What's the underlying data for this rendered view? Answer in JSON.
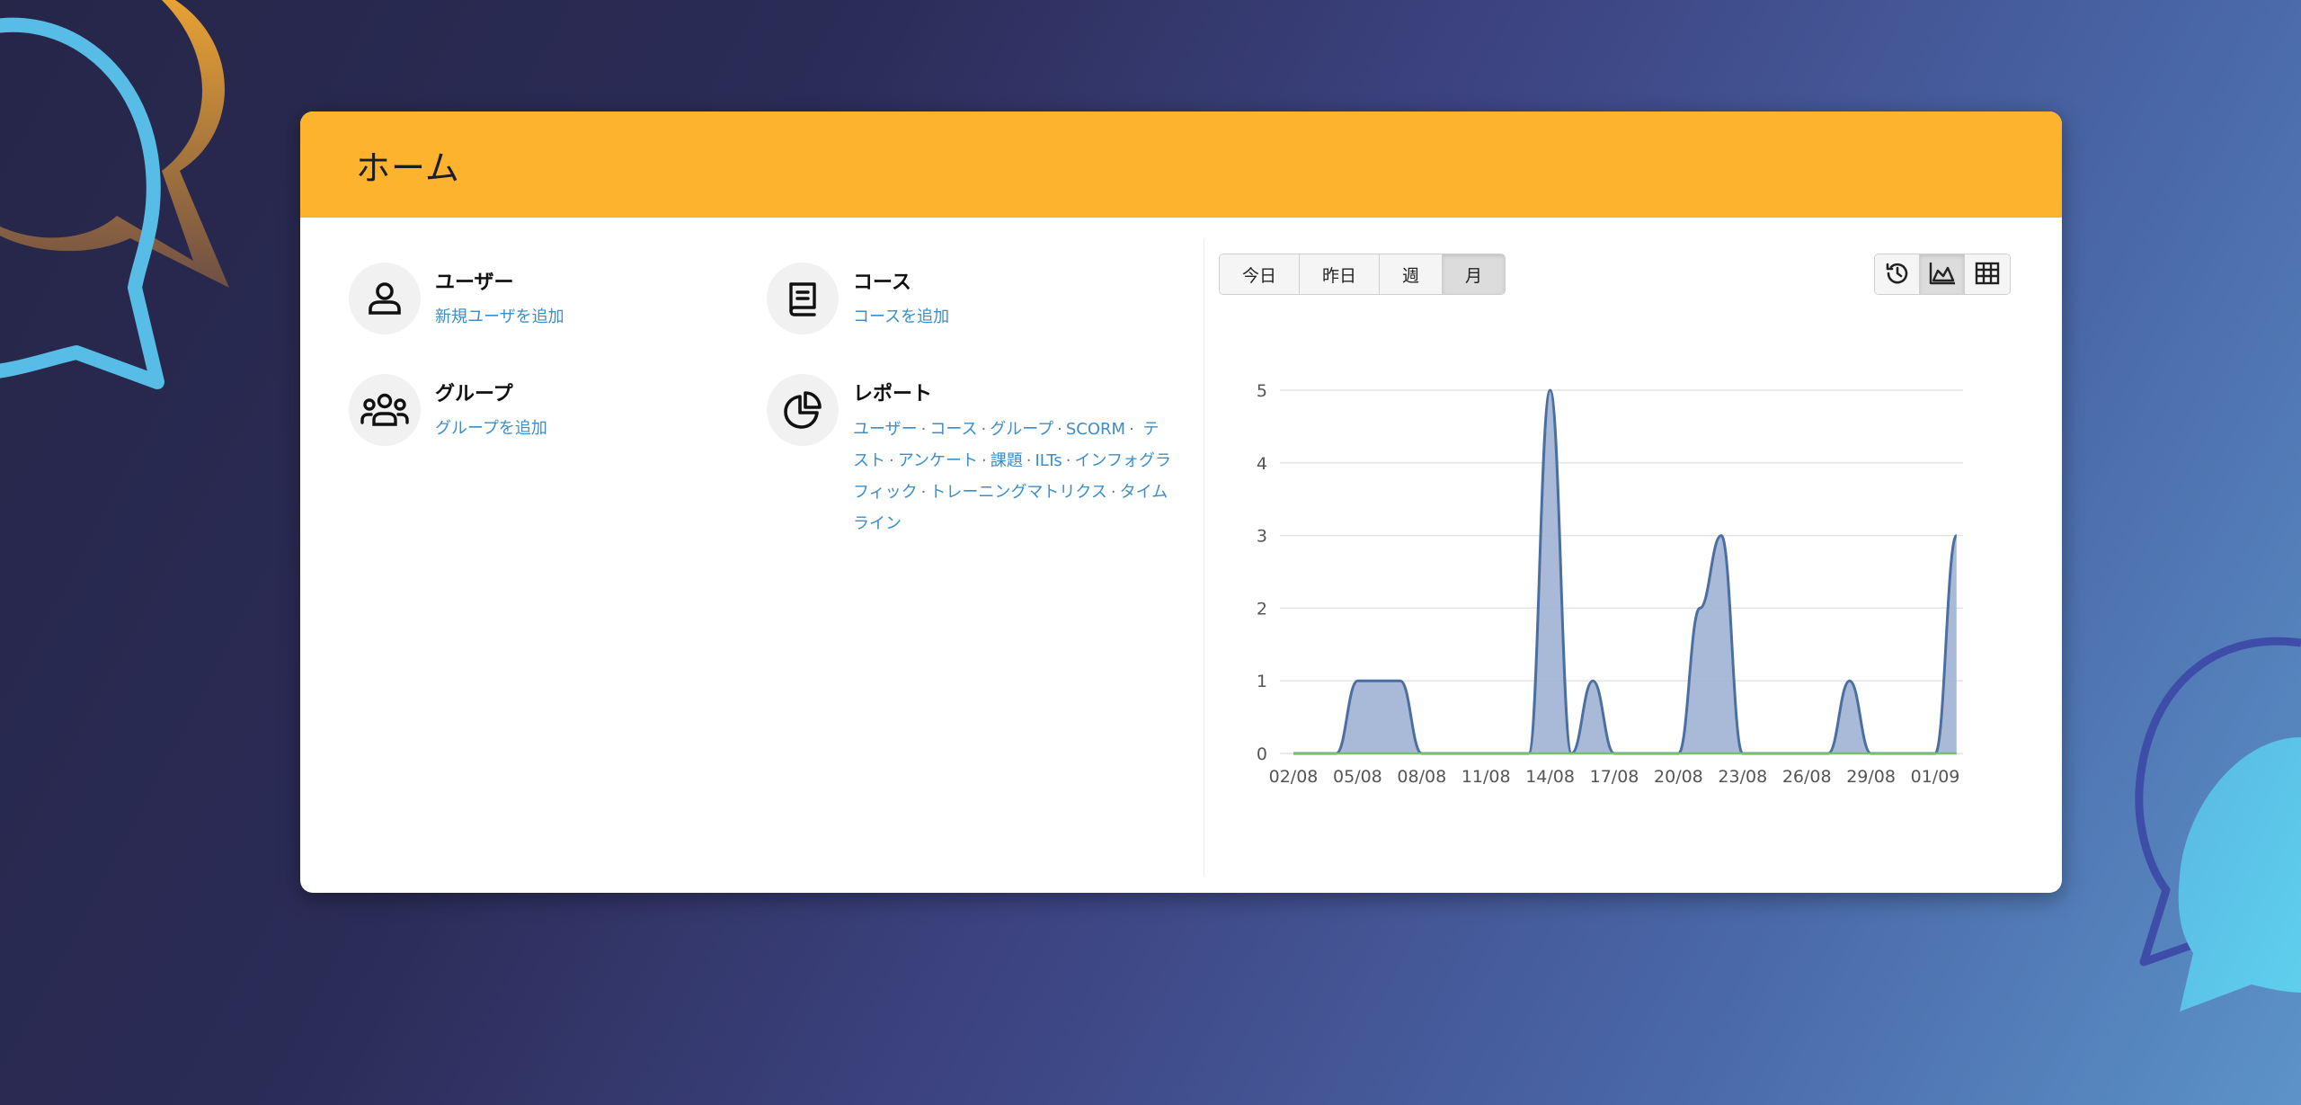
{
  "header": {
    "title": "ホーム"
  },
  "nav": {
    "users": {
      "title": "ユーザー",
      "link": "新規ユーザを追加",
      "icon": "user-icon"
    },
    "courses": {
      "title": "コース",
      "link": "コースを追加",
      "icon": "book-icon"
    },
    "groups": {
      "title": "グループ",
      "link": "グループを追加",
      "icon": "group-icon"
    },
    "reports": {
      "title": "レポート",
      "icon": "pie-chart-icon",
      "links": [
        "ユーザー",
        "コース",
        "グループ",
        "SCORM",
        "テスト",
        "アンケート",
        "課題",
        "ILTs",
        "インフォグラフィック",
        "トレーニングマトリクス",
        "タイムライン"
      ]
    }
  },
  "period_tabs": [
    {
      "label": "今日",
      "active": false
    },
    {
      "label": "昨日",
      "active": false
    },
    {
      "label": "週",
      "active": false
    },
    {
      "label": "月",
      "active": true
    }
  ],
  "view_buttons": [
    {
      "icon": "history-icon",
      "active": false
    },
    {
      "icon": "area-chart-icon",
      "active": true
    },
    {
      "icon": "table-icon",
      "active": false
    }
  ],
  "colors": {
    "header": "#fdb32d",
    "link": "#3b8ec9",
    "series_fill": "#9fb3d4",
    "series_line": "#4a6fa0",
    "baseline": "#7bbf6a"
  },
  "chart_data": {
    "type": "area",
    "x_tick_labels": [
      "02/08",
      "05/08",
      "08/08",
      "11/08",
      "14/08",
      "17/08",
      "20/08",
      "23/08",
      "26/08",
      "29/08",
      "01/09"
    ],
    "y_ticks": [
      0,
      1,
      2,
      3,
      4,
      5
    ],
    "ylim": [
      0,
      5
    ],
    "x": [
      "02/08",
      "03/08",
      "04/08",
      "05/08",
      "06/08",
      "07/08",
      "08/08",
      "09/08",
      "10/08",
      "11/08",
      "12/08",
      "13/08",
      "14/08",
      "15/08",
      "16/08",
      "17/08",
      "18/08",
      "19/08",
      "20/08",
      "21/08",
      "22/08",
      "23/08",
      "24/08",
      "25/08",
      "26/08",
      "27/08",
      "28/08",
      "29/08",
      "30/08",
      "31/08",
      "01/09",
      "02/09"
    ],
    "series": [
      {
        "values": [
          0,
          0,
          0,
          1,
          1,
          1,
          0,
          0,
          0,
          0,
          0,
          0,
          5,
          0,
          1,
          0,
          0,
          0,
          0,
          2,
          3,
          0,
          0,
          0,
          0,
          0,
          1,
          0,
          0,
          0,
          0,
          3
        ]
      },
      {
        "values": [
          0,
          0,
          0,
          0,
          0,
          0,
          0,
          0,
          0,
          0,
          0,
          0,
          0,
          0,
          0,
          0,
          0,
          0,
          0,
          0,
          0,
          0,
          0,
          0,
          0,
          0,
          0,
          0,
          0,
          0,
          0,
          0
        ]
      }
    ]
  }
}
